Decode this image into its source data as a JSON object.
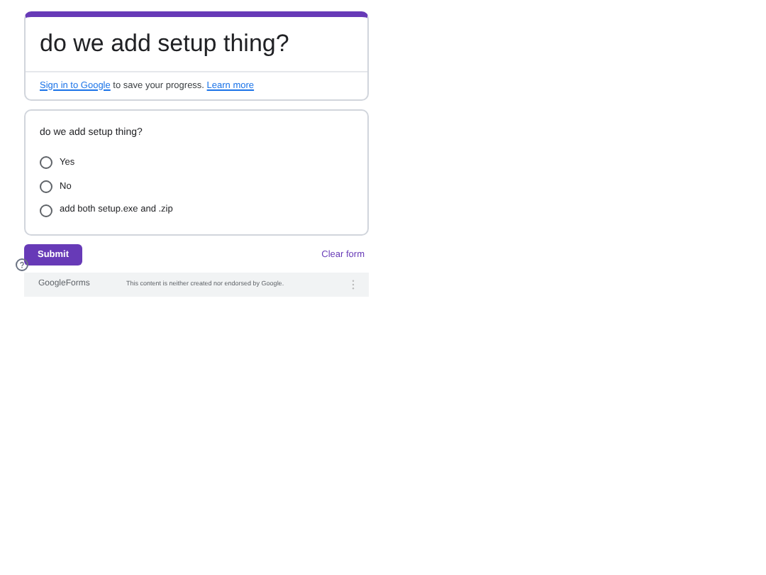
{
  "form": {
    "title": "do we add setup thing?",
    "signin_link": "Sign in to Google",
    "signin_text": " to save your progress. ",
    "learn_more": "Learn more"
  },
  "question": {
    "text": "do we add setup thing?",
    "options": [
      {
        "label": "Yes",
        "selected": false
      },
      {
        "label": "No",
        "selected": false
      },
      {
        "label": "add both setup.exe and .zip",
        "selected": false
      }
    ]
  },
  "submit": "Submit",
  "clear": "Clear form",
  "footer": {
    "brand_a": "Google",
    "brand_b": "Forms",
    "notice": "This content is neither created nor endorsed by Google."
  }
}
